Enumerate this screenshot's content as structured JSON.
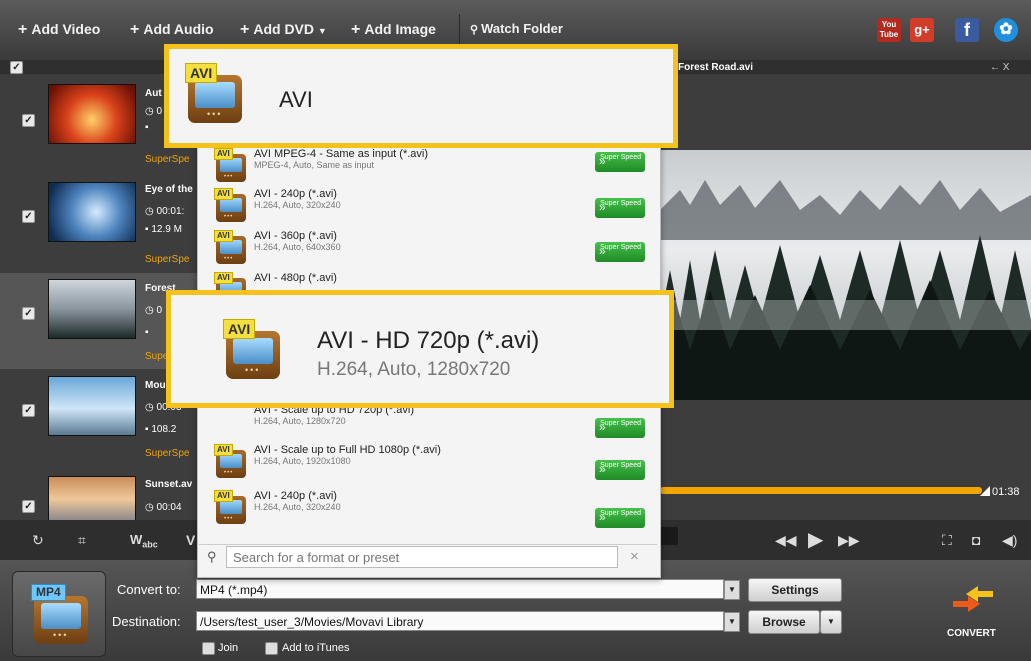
{
  "toolbar": {
    "add_video": "Add Video",
    "add_audio": "Add Audio",
    "add_dvd": "Add DVD",
    "add_image": "Add Image",
    "watch_folder": "Watch Folder",
    "social": {
      "youtube": "You Tube",
      "gplus": "g+",
      "facebook": "f"
    }
  },
  "preview": {
    "title": "Forest Road.avi",
    "time": "01:38",
    "window_controls": "← X"
  },
  "files": [
    {
      "name": "Aut",
      "duration": "0",
      "size": "",
      "superspeed": "SuperSpe"
    },
    {
      "name": "Eye of the",
      "duration": "00:01:",
      "size": "12.9 M",
      "superspeed": "SuperSpe"
    },
    {
      "name": "Forest",
      "duration": "0",
      "size": "",
      "superspeed": "Supe"
    },
    {
      "name": "Mou",
      "duration": "00:03",
      "size": "108.2",
      "superspeed": "SuperSpe"
    },
    {
      "name": "Sunset.av",
      "duration": "00:04",
      "size": "",
      "superspeed": ""
    }
  ],
  "dropdown": {
    "header_title": "AVI",
    "options": [
      {
        "title": "AVI MPEG-4 - Same as input (*.avi)",
        "sub": "MPEG-4, Auto, Same as input"
      },
      {
        "title": "AVI - 240p (*.avi)",
        "sub": "H.264, Auto, 320x240"
      },
      {
        "title": "AVI - 360p (*.avi)",
        "sub": "H.264, Auto, 640x360"
      },
      {
        "title": "AVI - 480p (*.avi)",
        "sub": ""
      },
      {
        "title": "AVI - Scale up to HD 720p (*.avi)",
        "sub": "H.264, Auto, 1280x720"
      },
      {
        "title": "AVI - Scale up to Full HD 1080p (*.avi)",
        "sub": "H.264, Auto, 1920x1080"
      },
      {
        "title": "AVI - 240p (*.avi)",
        "sub": "H.264, Auto, 320x240"
      }
    ],
    "highlight": {
      "title": "AVI - HD 720p (*.avi)",
      "sub": "H.264, Auto, 1280x720"
    },
    "icon_tag": "AVI",
    "superspeed_label": "Super Speed",
    "search_placeholder": "Search for a format or preset",
    "search_clear": "×"
  },
  "controls": {
    "watermark": "W",
    "watermark_sub": "abc"
  },
  "bottom": {
    "format_tag": "MP4",
    "convert_to_label": "Convert to:",
    "convert_to_value": "MP4 (*.mp4)",
    "settings_button": "Settings",
    "destination_label": "Destination:",
    "destination_value": "/Users/test_user_3/Movies/Movavi Library",
    "browse_button": "Browse",
    "join_label": "Join",
    "itunes_label": "Add to iTunes",
    "convert_label": "CONVERT"
  },
  "colors": {
    "accent": "#f5c21b",
    "superspeed": "#f0a500",
    "superspeed_badge": "#2ea836"
  }
}
